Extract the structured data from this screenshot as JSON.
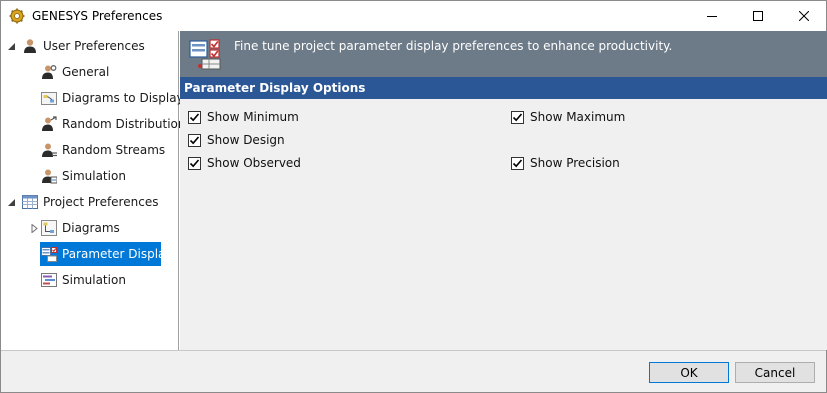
{
  "window": {
    "title": "GENESYS Preferences",
    "icon": "gear-icon"
  },
  "tree": {
    "groups": [
      {
        "label": "User Preferences",
        "icon": "user-icon",
        "expanded": true,
        "items": [
          {
            "label": "General",
            "icon": "user-settings-icon"
          },
          {
            "label": "Diagrams to Display",
            "icon": "diagram-icon"
          },
          {
            "label": "Random Distribution",
            "icon": "user-random-icon"
          },
          {
            "label": "Random Streams",
            "icon": "user-streams-icon"
          },
          {
            "label": "Simulation",
            "icon": "user-simulation-icon"
          }
        ]
      },
      {
        "label": "Project Preferences",
        "icon": "table-icon",
        "expanded": true,
        "items": [
          {
            "label": "Diagrams",
            "icon": "diagram-icon",
            "collapsed": true
          },
          {
            "label": "Parameter Display",
            "icon": "parameter-display-icon",
            "selected": true
          },
          {
            "label": "Simulation",
            "icon": "simulation-chart-icon"
          }
        ]
      }
    ]
  },
  "banner": {
    "text": "Fine tune project parameter display preferences to enhance productivity.",
    "icon": "parameter-display-icon"
  },
  "section": {
    "title": "Parameter Display Options"
  },
  "options": {
    "show_minimum": {
      "label": "Show Minimum",
      "checked": true
    },
    "show_maximum": {
      "label": "Show Maximum",
      "checked": true
    },
    "show_design": {
      "label": "Show Design",
      "checked": true
    },
    "show_observed": {
      "label": "Show Observed",
      "checked": true
    },
    "show_precision": {
      "label": "Show Precision",
      "checked": true
    }
  },
  "footer": {
    "ok_label": "OK",
    "cancel_label": "Cancel"
  },
  "colors": {
    "banner": "#6d7a88",
    "section_header": "#2b5797",
    "selection": "#0078d7"
  }
}
